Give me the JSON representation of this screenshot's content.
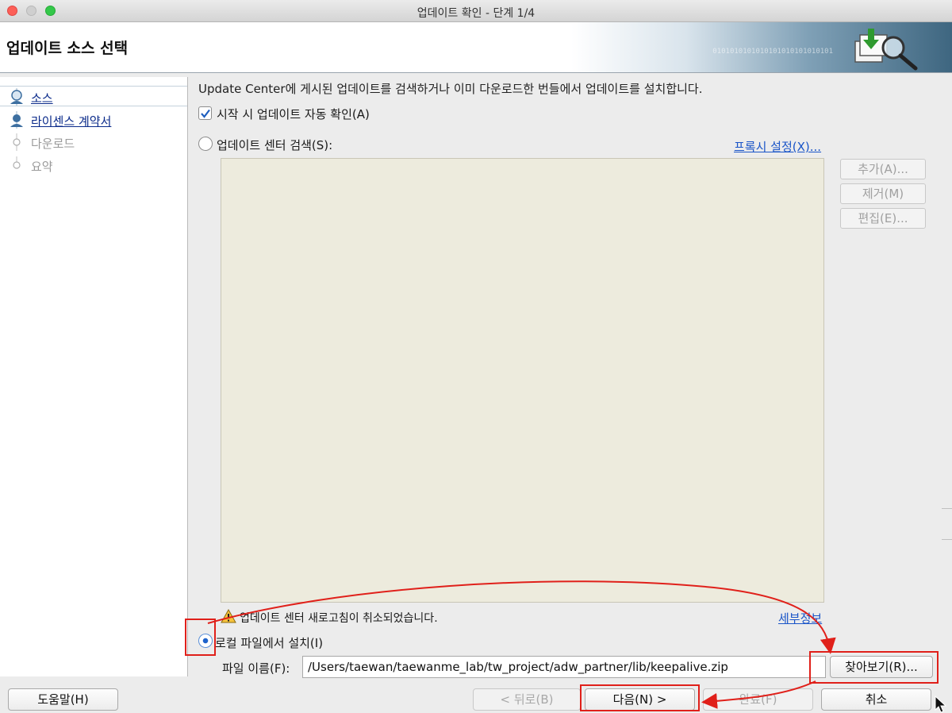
{
  "window": {
    "title": "업데이트 확인 - 단계 1/4"
  },
  "header": {
    "title": "업데이트 소스 선택",
    "binary_text": "0101010101010101010101010101"
  },
  "steps": [
    {
      "label": "소스",
      "state": "active"
    },
    {
      "label": "라이센스 계약서",
      "state": "link"
    },
    {
      "label": "다운로드",
      "state": "disabled"
    },
    {
      "label": "요약",
      "state": "disabled"
    }
  ],
  "main": {
    "description": "Update Center에 게시된 업데이트를 검색하거나 이미 다운로드한 번들에서 업데이트를 설치합니다.",
    "auto_check": {
      "label": "시작 시 업데이트 자동 확인(A)",
      "checked": true
    },
    "search_radio": {
      "label": "업데이트 센터 검색(S):",
      "selected": false
    },
    "proxy_link": "프록시 설정(X)...",
    "side_buttons": {
      "add": "추가(A)...",
      "remove": "제거(M)",
      "edit": "편집(E)..."
    },
    "warning": "업데이트 센터 새로고침이 취소되었습니다.",
    "details_link": "세부정보",
    "local_radio": {
      "label": "로컬 파일에서 설치(I)",
      "selected": true
    },
    "file_label": "파일 이름(F):",
    "file_value": "/Users/taewan/taewanme_lab/tw_project/adw_partner/lib/keepalive.zip",
    "browse": "찾아보기(R)..."
  },
  "footer": {
    "help": "도움말(H)",
    "back": "< 뒤로(B)",
    "next": "다음(N) >",
    "finish": "완료(F)",
    "cancel": "취소"
  },
  "colors": {
    "annotation": "#e0201a",
    "link": "#1a55c8",
    "list_bg": "#edebdd"
  }
}
